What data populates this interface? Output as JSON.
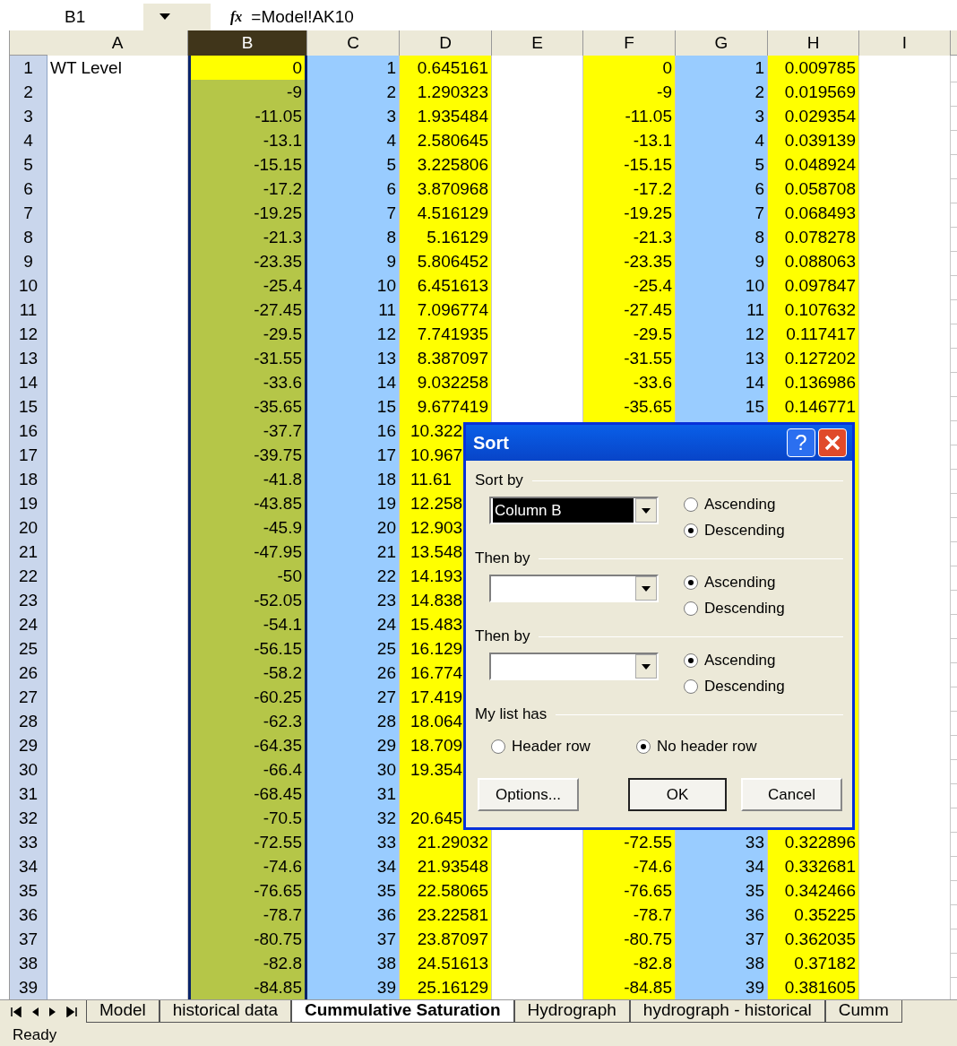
{
  "formula_bar": {
    "name_box": "B1",
    "fx_label": "fx",
    "formula": "=Model!AK10"
  },
  "columns": [
    {
      "label": "A",
      "selected": false
    },
    {
      "label": "B",
      "selected": true,
      "color": "#ffff00"
    },
    {
      "label": "C",
      "selected": false,
      "color": "#99ccff"
    },
    {
      "label": "D",
      "selected": false,
      "color": "#ffff00"
    },
    {
      "label": "E",
      "selected": false
    },
    {
      "label": "F",
      "selected": false,
      "color": "#ffff00"
    },
    {
      "label": "G",
      "selected": false,
      "color": "#99ccff"
    },
    {
      "label": "H",
      "selected": false,
      "color": "#ffff00"
    },
    {
      "label": "I",
      "selected": false
    }
  ],
  "rows": [
    {
      "header": "1",
      "active": true,
      "covered": false,
      "cells": {
        "a": "WT Level",
        "b": "0",
        "c": "1",
        "d": "0.645161",
        "f": "0",
        "g": "1",
        "h": "0.009785"
      }
    },
    {
      "header": "2",
      "active": false,
      "covered": false,
      "cells": {
        "b": "-9",
        "c": "2",
        "d": "1.290323",
        "f": "-9",
        "g": "2",
        "h": "0.019569"
      }
    },
    {
      "header": "3",
      "active": false,
      "covered": false,
      "cells": {
        "b": "-11.05",
        "c": "3",
        "d": "1.935484",
        "f": "-11.05",
        "g": "3",
        "h": "0.029354"
      }
    },
    {
      "header": "4",
      "active": false,
      "covered": false,
      "cells": {
        "b": "-13.1",
        "c": "4",
        "d": "2.580645",
        "f": "-13.1",
        "g": "4",
        "h": "0.039139"
      }
    },
    {
      "header": "5",
      "active": false,
      "covered": false,
      "cells": {
        "b": "-15.15",
        "c": "5",
        "d": "3.225806",
        "f": "-15.15",
        "g": "5",
        "h": "0.048924"
      }
    },
    {
      "header": "6",
      "active": false,
      "covered": false,
      "cells": {
        "b": "-17.2",
        "c": "6",
        "d": "3.870968",
        "f": "-17.2",
        "g": "6",
        "h": "0.058708"
      }
    },
    {
      "header": "7",
      "active": false,
      "covered": false,
      "cells": {
        "b": "-19.25",
        "c": "7",
        "d": "4.516129",
        "f": "-19.25",
        "g": "7",
        "h": "0.068493"
      }
    },
    {
      "header": "8",
      "active": false,
      "covered": false,
      "cells": {
        "b": "-21.3",
        "c": "8",
        "d": "5.16129",
        "f": "-21.3",
        "g": "8",
        "h": "0.078278"
      }
    },
    {
      "header": "9",
      "active": false,
      "covered": false,
      "cells": {
        "b": "-23.35",
        "c": "9",
        "d": "5.806452",
        "f": "-23.35",
        "g": "9",
        "h": "0.088063"
      }
    },
    {
      "header": "10",
      "active": false,
      "covered": false,
      "cells": {
        "b": "-25.4",
        "c": "10",
        "d": "6.451613",
        "f": "-25.4",
        "g": "10",
        "h": "0.097847"
      }
    },
    {
      "header": "11",
      "active": false,
      "covered": false,
      "cells": {
        "b": "-27.45",
        "c": "11",
        "d": "7.096774",
        "f": "-27.45",
        "g": "11",
        "h": "0.107632"
      }
    },
    {
      "header": "12",
      "active": false,
      "covered": false,
      "cells": {
        "b": "-29.5",
        "c": "12",
        "d": "7.741935",
        "f": "-29.5",
        "g": "12",
        "h": "0.117417"
      }
    },
    {
      "header": "13",
      "active": false,
      "covered": false,
      "cells": {
        "b": "-31.55",
        "c": "13",
        "d": "8.387097",
        "f": "-31.55",
        "g": "13",
        "h": "0.127202"
      }
    },
    {
      "header": "14",
      "active": false,
      "covered": false,
      "cells": {
        "b": "-33.6",
        "c": "14",
        "d": "9.032258",
        "f": "-33.6",
        "g": "14",
        "h": "0.136986"
      }
    },
    {
      "header": "15",
      "active": false,
      "covered": false,
      "cells": {
        "b": "-35.65",
        "c": "15",
        "d": "9.677419",
        "f": "-35.65",
        "g": "15",
        "h": "0.146771"
      }
    },
    {
      "header": "16",
      "active": false,
      "covered": true,
      "cells": {
        "b": "-37.7",
        "c": "16",
        "d": "10.322"
      }
    },
    {
      "header": "17",
      "active": false,
      "covered": true,
      "cells": {
        "b": "-39.75",
        "c": "17",
        "d": "10.967"
      }
    },
    {
      "header": "18",
      "active": false,
      "covered": true,
      "cells": {
        "b": "-41.8",
        "c": "18",
        "d": "11.61"
      }
    },
    {
      "header": "19",
      "active": false,
      "covered": true,
      "cells": {
        "b": "-43.85",
        "c": "19",
        "d": "12.258"
      }
    },
    {
      "header": "20",
      "active": false,
      "covered": true,
      "cells": {
        "b": "-45.9",
        "c": "20",
        "d": "12.903"
      }
    },
    {
      "header": "21",
      "active": false,
      "covered": true,
      "cells": {
        "b": "-47.95",
        "c": "21",
        "d": "13.548"
      }
    },
    {
      "header": "22",
      "active": false,
      "covered": true,
      "cells": {
        "b": "-50",
        "c": "22",
        "d": "14.193"
      }
    },
    {
      "header": "23",
      "active": false,
      "covered": true,
      "cells": {
        "b": "-52.05",
        "c": "23",
        "d": "14.838"
      }
    },
    {
      "header": "24",
      "active": false,
      "covered": true,
      "cells": {
        "b": "-54.1",
        "c": "24",
        "d": "15.483"
      }
    },
    {
      "header": "25",
      "active": false,
      "covered": true,
      "cells": {
        "b": "-56.15",
        "c": "25",
        "d": "16.129"
      }
    },
    {
      "header": "26",
      "active": false,
      "covered": true,
      "cells": {
        "b": "-58.2",
        "c": "26",
        "d": "16.774"
      }
    },
    {
      "header": "27",
      "active": false,
      "covered": true,
      "cells": {
        "b": "-60.25",
        "c": "27",
        "d": "17.419"
      }
    },
    {
      "header": "28",
      "active": false,
      "covered": true,
      "cells": {
        "b": "-62.3",
        "c": "28",
        "d": "18.064"
      }
    },
    {
      "header": "29",
      "active": false,
      "covered": true,
      "cells": {
        "b": "-64.35",
        "c": "29",
        "d": "18.709"
      }
    },
    {
      "header": "30",
      "active": false,
      "covered": true,
      "cells": {
        "b": "-66.4",
        "c": "30",
        "d": "19.354"
      }
    },
    {
      "header": "31",
      "active": false,
      "cells": {
        "b": "-68.45",
        "c": "31"
      }
    },
    {
      "header": "32",
      "active": false,
      "covered": true,
      "cells": {
        "b": "-70.5",
        "c": "32",
        "d": "20.645"
      }
    },
    {
      "header": "33",
      "active": false,
      "covered": false,
      "cells": {
        "b": "-72.55",
        "c": "33",
        "d": "21.29032",
        "f": "-72.55",
        "g": "33",
        "h": "0.322896"
      }
    },
    {
      "header": "34",
      "active": false,
      "covered": false,
      "cells": {
        "b": "-74.6",
        "c": "34",
        "d": "21.93548",
        "f": "-74.6",
        "g": "34",
        "h": "0.332681"
      }
    },
    {
      "header": "35",
      "active": false,
      "covered": false,
      "cells": {
        "b": "-76.65",
        "c": "35",
        "d": "22.58065",
        "f": "-76.65",
        "g": "35",
        "h": "0.342466"
      }
    },
    {
      "header": "36",
      "active": false,
      "covered": false,
      "cells": {
        "b": "-78.7",
        "c": "36",
        "d": "23.22581",
        "f": "-78.7",
        "g": "36",
        "h": "0.35225"
      }
    },
    {
      "header": "37",
      "active": false,
      "covered": false,
      "cells": {
        "b": "-80.75",
        "c": "37",
        "d": "23.87097",
        "f": "-80.75",
        "g": "37",
        "h": "0.362035"
      }
    },
    {
      "header": "38",
      "active": false,
      "covered": false,
      "cells": {
        "b": "-82.8",
        "c": "38",
        "d": "24.51613",
        "f": "-82.8",
        "g": "38",
        "h": "0.37182"
      }
    },
    {
      "header": "39",
      "active": false,
      "covered": false,
      "cells": {
        "b": "-84.85",
        "c": "39",
        "d": "25.16129",
        "f": "-84.85",
        "g": "39",
        "h": "0.381605"
      }
    }
  ],
  "dialog": {
    "title": "Sort",
    "help_button": "?",
    "groups": [
      {
        "label": "Sort by",
        "field": {
          "value": "Column B",
          "highlighted": true
        },
        "options": [
          {
            "label": "Ascending",
            "selected": false
          },
          {
            "label": "Descending",
            "selected": true
          }
        ]
      },
      {
        "label": "Then by",
        "field": {
          "highlighted": false
        },
        "options": [
          {
            "label": "Ascending",
            "selected": true
          },
          {
            "label": "Descending",
            "selected": false
          }
        ]
      },
      {
        "label": "Then by",
        "field": {
          "highlighted": false
        },
        "options": [
          {
            "label": "Ascending",
            "selected": true
          },
          {
            "label": "Descending",
            "selected": false
          }
        ]
      }
    ],
    "list_has": {
      "label": "My list has",
      "options": [
        {
          "label": "Header row",
          "selected": false
        },
        {
          "label": "No header row",
          "selected": true
        }
      ]
    },
    "buttons": [
      {
        "label": "Options...",
        "default": false
      },
      {
        "label": "OK",
        "default": true
      },
      {
        "label": "Cancel",
        "default": false
      }
    ]
  },
  "sheet_tabs": [
    {
      "label": "Model",
      "selected": false
    },
    {
      "label": "historical data",
      "selected": false
    },
    {
      "label": "Cummulative Saturation",
      "selected": true
    },
    {
      "label": "Hydrograph",
      "selected": false
    },
    {
      "label": "hydrograph - historical",
      "selected": false
    },
    {
      "label": "Cumm",
      "selected": false
    }
  ],
  "status_bar": {
    "text": "Ready"
  }
}
